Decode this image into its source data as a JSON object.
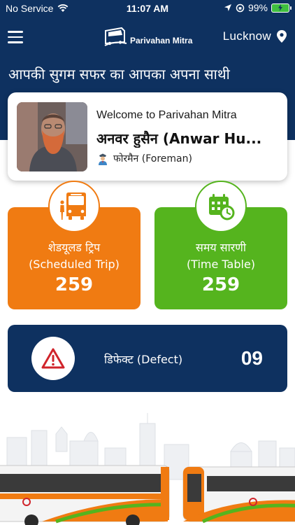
{
  "status_bar": {
    "carrier": "No Service",
    "time": "11:07 AM",
    "battery": "99%"
  },
  "app_bar": {
    "logo_text": "Parivahan Mitra",
    "location": "Lucknow"
  },
  "tagline": "आपकी सुगम सफर का आपका अपना साथी",
  "profile": {
    "welcome": "Welcome to Parivahan Mitra",
    "name": "अनवर हुसैन (Anwar Hu...",
    "role": "फोरमैन (Foreman)"
  },
  "tiles": {
    "scheduled": {
      "label_hi": "शेडयूलड ट्रिप",
      "label_en": "(Scheduled Trip)",
      "count": "259",
      "icon": "bus-icon",
      "color": "#f07b12"
    },
    "timetable": {
      "label_hi": "समय सारणी",
      "label_en": "(Time Table)",
      "count": "259",
      "icon": "calendar-clock-icon",
      "color": "#55b41e"
    }
  },
  "defect": {
    "label": "डिफेक्ट (Defect)",
    "count": "09",
    "icon": "warning-icon",
    "color": "#d0242b"
  },
  "colors": {
    "primary": "#0e3160"
  }
}
